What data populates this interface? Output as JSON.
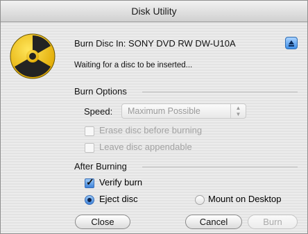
{
  "window": {
    "title": "Disk Utility"
  },
  "burn": {
    "label": "Burn Disc In:",
    "device": "SONY DVD RW DW-U10A",
    "status": "Waiting for a disc to be inserted..."
  },
  "options": {
    "heading": "Burn Options",
    "speed_label": "Speed:",
    "speed_value": "Maximum Possible",
    "erase_label": "Erase disc before burning",
    "erase_checked": false,
    "appendable_label": "Leave disc appendable",
    "appendable_checked": false
  },
  "after": {
    "heading": "After Burning",
    "verify_label": "Verify burn",
    "verify_checked": true,
    "eject_label": "Eject disc",
    "mount_label": "Mount on Desktop",
    "selected": "eject"
  },
  "buttons": {
    "close": "Close",
    "cancel": "Cancel",
    "burn": "Burn"
  },
  "icons": {
    "burn": "radiation-burn-icon",
    "eject": "eject-icon"
  },
  "colors": {
    "accent": "#3d82d9",
    "burn_icon_yellow": "#f2c400",
    "burn_icon_dark": "#2a2a2a"
  }
}
